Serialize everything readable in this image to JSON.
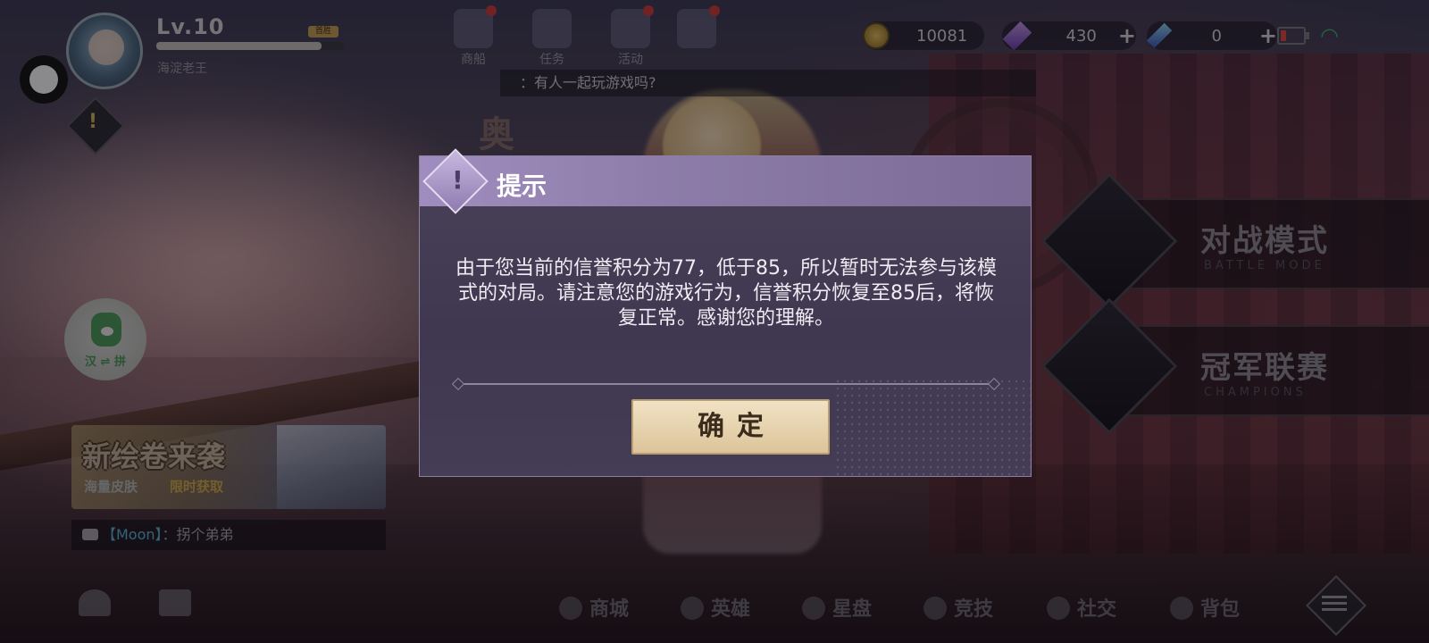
{
  "player": {
    "level": "Lv.10",
    "level_progress": 0.88,
    "level_badge": "首胜",
    "name": "海淀老王"
  },
  "top_nav": [
    {
      "label": "商船",
      "icon": "ship-icon"
    },
    {
      "label": "任务",
      "icon": "task-icon"
    },
    {
      "label": "活动",
      "icon": "megaphone-icon"
    },
    {
      "label": "",
      "icon": "event-icon"
    }
  ],
  "resources": {
    "gold": "10081",
    "purple_gem": "430",
    "blue_gem": "0"
  },
  "chat_broadcast": "：有人一起玩游戏吗?",
  "partial_title": "奥",
  "green_widget_label": "汉 ⇌ 拼",
  "banner": {
    "title": "新绘卷来袭",
    "subtitle_left": "海量皮肤",
    "subtitle_right": "限时获取"
  },
  "world_chat": {
    "name": "【Moon】",
    "message": "：拐个弟弟"
  },
  "modes": [
    {
      "zh": "对战模式",
      "en": "BATTLE MODE"
    },
    {
      "zh": "冠军联赛",
      "en": "CHAMPIONS"
    }
  ],
  "bottom_nav": [
    "商城",
    "英雄",
    "星盘",
    "竞技",
    "社交",
    "背包"
  ],
  "dialog": {
    "title": "提示",
    "message": "由于您当前的信誉积分为77，低于85，所以暂时无法参与该模式的对局。请注意您的游戏行为，信誉积分恢复至85后，将恢复正常。感谢您的理解。",
    "confirm": "确定"
  },
  "colors": {
    "dialog_header": "#a08dbf",
    "dialog_body": "#443c55",
    "confirm_button": "#e8d6b2",
    "wifi": "#39b86b",
    "battery_low": "#e04a3a"
  }
}
